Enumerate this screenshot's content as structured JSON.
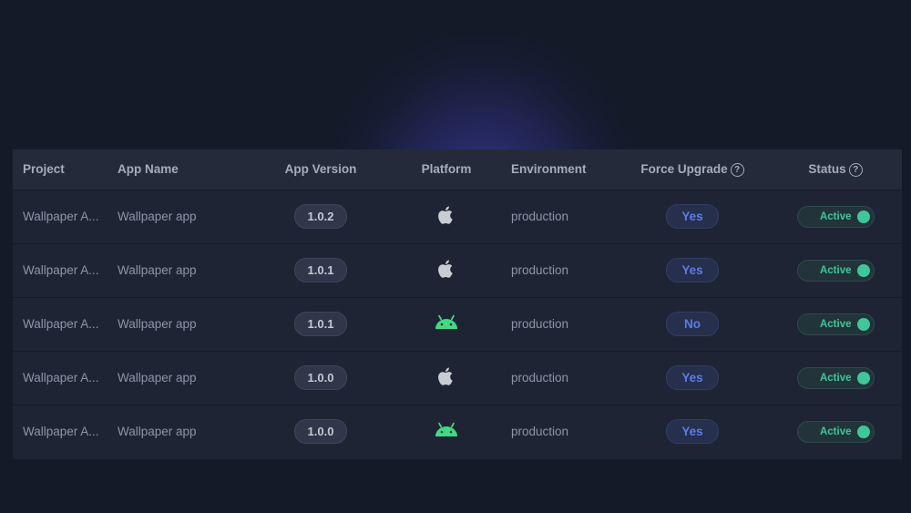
{
  "table": {
    "headers": {
      "project": "Project",
      "app_name": "App Name",
      "app_version": "App Version",
      "platform": "Platform",
      "environment": "Environment",
      "force_upgrade": "Force Upgrade",
      "status": "Status"
    },
    "rows": [
      {
        "project": "Wallpaper A...",
        "app_name": "Wallpaper app",
        "version": "1.0.2",
        "platform": "apple-icon",
        "environment": "production",
        "force_upgrade": "Yes",
        "status": "Active"
      },
      {
        "project": "Wallpaper A...",
        "app_name": "Wallpaper app",
        "version": "1.0.1",
        "platform": "apple-icon",
        "environment": "production",
        "force_upgrade": "Yes",
        "status": "Active"
      },
      {
        "project": "Wallpaper A...",
        "app_name": "Wallpaper app",
        "version": "1.0.1",
        "platform": "android-icon",
        "environment": "production",
        "force_upgrade": "No",
        "status": "Active"
      },
      {
        "project": "Wallpaper A...",
        "app_name": "Wallpaper app",
        "version": "1.0.0",
        "platform": "apple-icon",
        "environment": "production",
        "force_upgrade": "Yes",
        "status": "Active"
      },
      {
        "project": "Wallpaper A...",
        "app_name": "Wallpaper app",
        "version": "1.0.0",
        "platform": "android-icon",
        "environment": "production",
        "force_upgrade": "Yes",
        "status": "Active"
      }
    ]
  },
  "icons": {
    "help": "question-circle-icon",
    "apple": "apple-icon",
    "android": "android-icon"
  },
  "colors": {
    "background": "#141a28",
    "table_bg": "#1e2434",
    "active": "#3ec79a",
    "force_text": "#5d7ce8",
    "android": "#3ddc84",
    "apple": "#c9ccd3"
  }
}
